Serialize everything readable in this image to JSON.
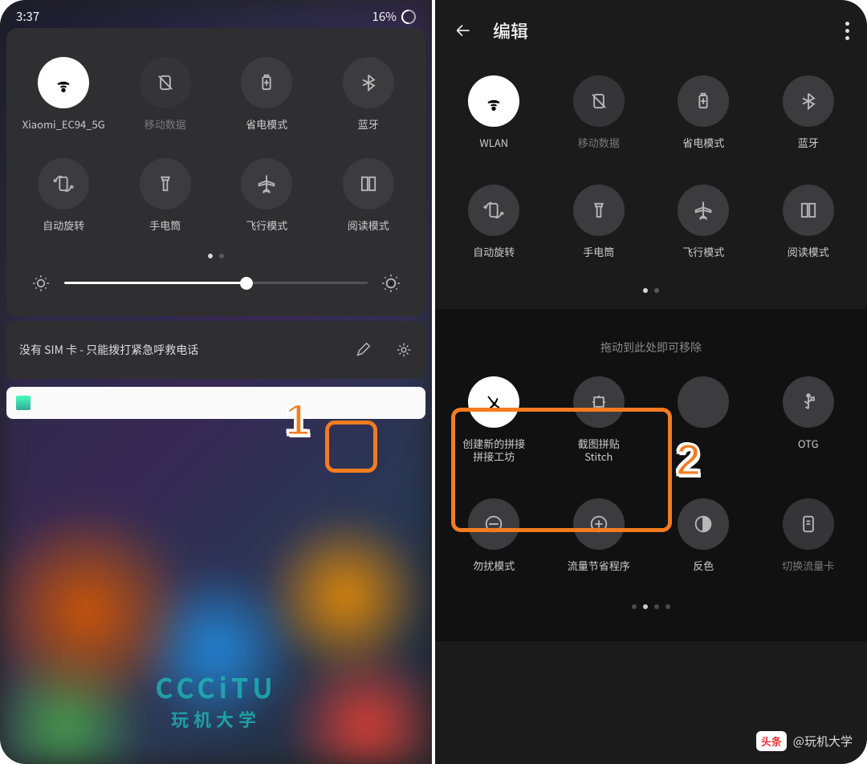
{
  "status": {
    "time": "3:37",
    "battery": "16%"
  },
  "left_panel": {
    "row1": [
      {
        "label": "Xiaomi_EC94_5G",
        "icon": "wifi-icon",
        "active": true
      },
      {
        "label": "移动数据",
        "icon": "no-sim-icon",
        "dim": true
      },
      {
        "label": "省电模式",
        "icon": "battery-icon"
      },
      {
        "label": "蓝牙",
        "icon": "bluetooth-icon"
      }
    ],
    "row2": [
      {
        "label": "自动旋转",
        "icon": "rotate-icon"
      },
      {
        "label": "手电筒",
        "icon": "flashlight-icon"
      },
      {
        "label": "飞行模式",
        "icon": "airplane-icon"
      },
      {
        "label": "阅读模式",
        "icon": "read-icon"
      }
    ],
    "sim_text": "没有 SIM 卡 - 只能拨打紧急呼救电话"
  },
  "right_panel": {
    "title": "编辑",
    "row1": [
      {
        "label": "WLAN",
        "icon": "wifi-icon",
        "active": true
      },
      {
        "label": "移动数据",
        "icon": "no-sim-icon",
        "dim": true
      },
      {
        "label": "省电模式",
        "icon": "battery-icon"
      },
      {
        "label": "蓝牙",
        "icon": "bluetooth-icon"
      }
    ],
    "row2": [
      {
        "label": "自动旋转",
        "icon": "rotate-icon"
      },
      {
        "label": "手电筒",
        "icon": "flashlight-icon"
      },
      {
        "label": "飞行模式",
        "icon": "airplane-icon"
      },
      {
        "label": "阅读模式",
        "icon": "read-icon"
      }
    ],
    "drop_hint": "拖动到此处即可移除",
    "row3": [
      {
        "label": "创建新的拼接\n拼接工坊",
        "icon": "stitch-create-icon",
        "active": true
      },
      {
        "label": "截图拼贴\nStitch",
        "icon": "stitch-icon"
      },
      {
        "label": "",
        "icon": "blank-icon",
        "hidden_by_callout": true
      },
      {
        "label": "OTG",
        "icon": "usb-icon"
      }
    ],
    "row4": [
      {
        "label": "勿扰模式",
        "icon": "dnd-icon"
      },
      {
        "label": "流量节省程序",
        "icon": "data-saver-icon"
      },
      {
        "label": "反色",
        "icon": "invert-icon"
      },
      {
        "label": "切换流量卡",
        "icon": "sim-switch-icon",
        "dim": true
      }
    ]
  },
  "callouts": {
    "one": "1",
    "two": "2"
  },
  "watermark": {
    "left1": "CCCiTU",
    "left2": "玩机大学",
    "toutiao_badge": "头条",
    "toutiao_text": "@玩机大学"
  }
}
